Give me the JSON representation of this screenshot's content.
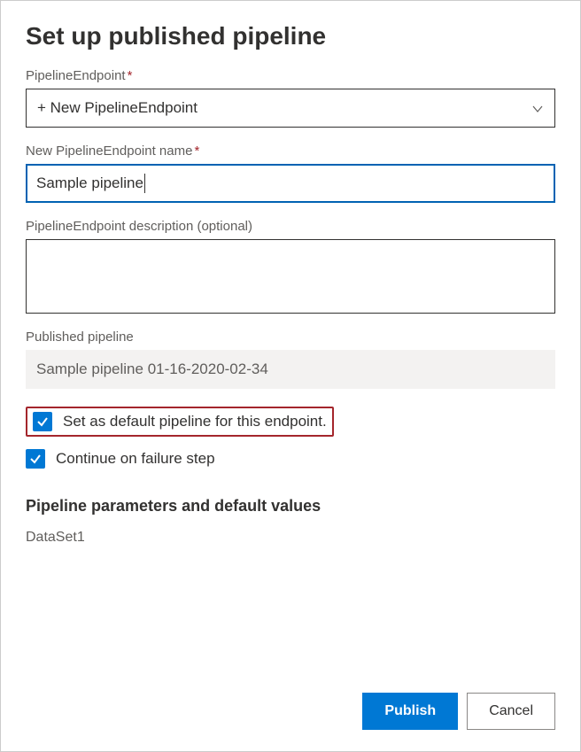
{
  "dialog": {
    "title": "Set up published pipeline"
  },
  "fields": {
    "endpoint": {
      "label": "PipelineEndpoint",
      "value": "+ New PipelineEndpoint"
    },
    "name": {
      "label": "New PipelineEndpoint name",
      "value": "Sample pipeline"
    },
    "description": {
      "label": "PipelineEndpoint description (optional)",
      "value": ""
    },
    "published": {
      "label": "Published pipeline",
      "value": "Sample pipeline 01-16-2020-02-34"
    }
  },
  "checkboxes": {
    "set_default": {
      "label": "Set as default pipeline for this endpoint.",
      "checked": true
    },
    "continue_failure": {
      "label": "Continue on failure step",
      "checked": true
    }
  },
  "parameters": {
    "heading": "Pipeline parameters and default values",
    "items": [
      "DataSet1"
    ]
  },
  "buttons": {
    "publish": "Publish",
    "cancel": "Cancel"
  }
}
